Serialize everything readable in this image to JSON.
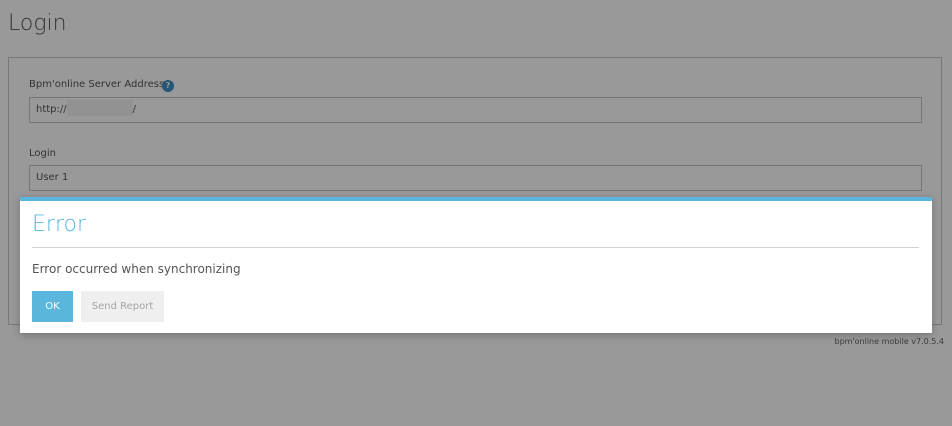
{
  "page": {
    "title": "Login",
    "version": "bpm'online mobile v7.0.5.4"
  },
  "form": {
    "server_label": "Bpm'online Server Address",
    "server_prefix": "http://",
    "server_suffix": "/",
    "help_icon_glyph": "?",
    "login_label": "Login",
    "login_value": "User 1"
  },
  "dialog": {
    "title": "Error",
    "message": "Error occurred when synchronizing",
    "ok_label": "OK",
    "report_label": "Send Report"
  },
  "colors": {
    "accent": "#5ab6dd",
    "help_icon": "#3d8fc3",
    "overlay": "rgba(0,0,0,0.4)"
  }
}
